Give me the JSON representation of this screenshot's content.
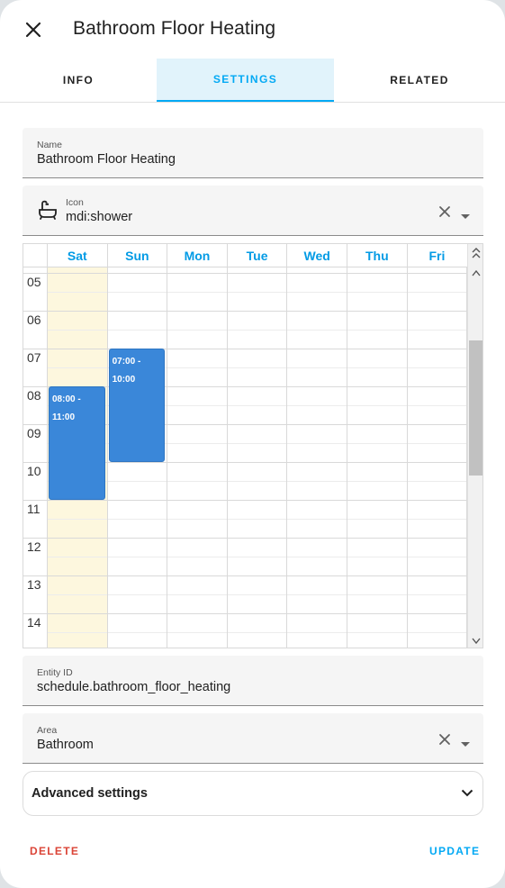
{
  "dialog": {
    "title": "Bathroom Floor Heating"
  },
  "tabs": [
    {
      "label": "INFO",
      "active": false
    },
    {
      "label": "SETTINGS",
      "active": true
    },
    {
      "label": "RELATED",
      "active": false
    }
  ],
  "form": {
    "name": {
      "label": "Name",
      "value": "Bathroom Floor Heating"
    },
    "icon": {
      "label": "Icon",
      "value": "mdi:shower",
      "preview_icon": "bathtub-icon"
    },
    "entity_id": {
      "label": "Entity ID",
      "value": "schedule.bathroom_floor_heating"
    },
    "area": {
      "label": "Area",
      "value": "Bathroom"
    }
  },
  "schedule": {
    "days": [
      "Sat",
      "Sun",
      "Mon",
      "Tue",
      "Wed",
      "Thu",
      "Fri"
    ],
    "today": "Sat",
    "hours": [
      "05",
      "06",
      "07",
      "08",
      "09",
      "10",
      "11",
      "12",
      "13",
      "14"
    ],
    "events": [
      {
        "day": "Sat",
        "start": "08:00",
        "end": "11:00",
        "label_line1": "08:00 -",
        "label_line2": "11:00"
      },
      {
        "day": "Sun",
        "start": "07:00",
        "end": "10:00",
        "label_line1": "07:00 -",
        "label_line2": "10:00"
      }
    ],
    "first_visible_hour": 5,
    "scroll_position_fraction": 0.28
  },
  "advanced": {
    "label": "Advanced settings"
  },
  "buttons": {
    "delete": "DELETE",
    "update": "UPDATE"
  },
  "colors": {
    "accent": "#03a9f4",
    "day_header": "#039be5",
    "event": "#3a87d9",
    "today_bg": "#fdf7de",
    "delete": "#db4437"
  }
}
